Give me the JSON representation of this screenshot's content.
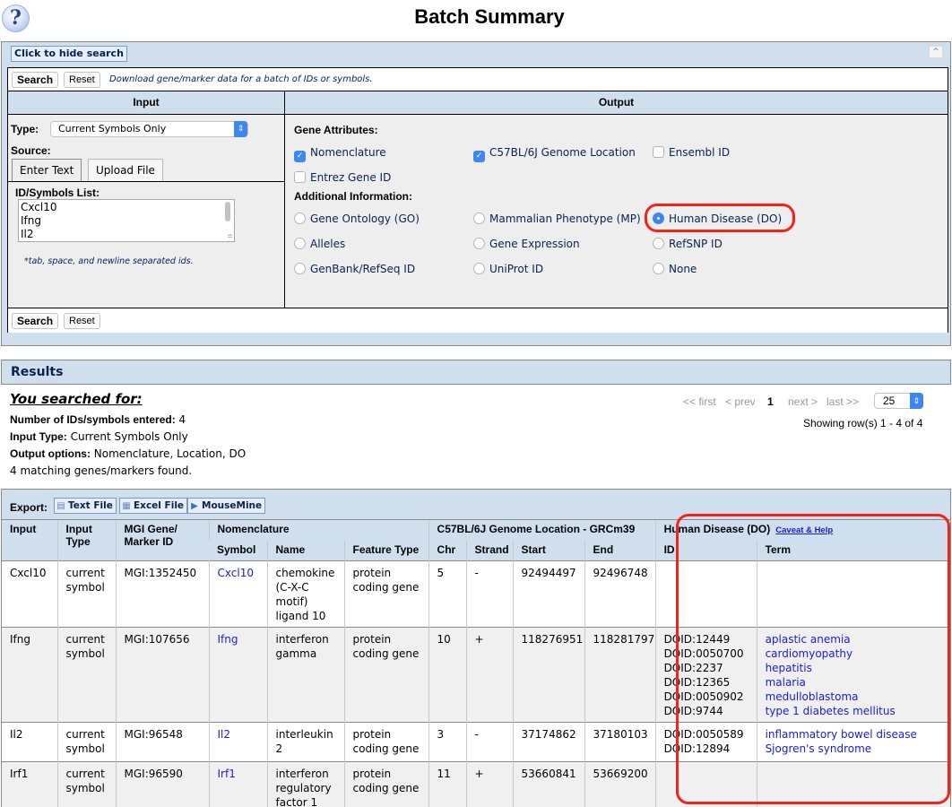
{
  "header": {
    "title": "Batch Summary",
    "help_icon_glyph": "?"
  },
  "query_form": {
    "hide_search_label": "Click to hide search",
    "collapse_icon_glyph": "^",
    "search_label": "Search",
    "reset_label": "Reset",
    "description": "Download gene/marker data for a batch of IDs or symbols.",
    "input": {
      "heading": "Input",
      "type_label": "Type:",
      "type_value": "Current Symbols Only",
      "source_label": "Source:",
      "tabs": [
        {
          "label": "Enter Text",
          "active": true
        },
        {
          "label": "Upload File",
          "active": false
        }
      ],
      "list_label": "ID/Symbols List:",
      "list_lines": [
        "Cxcl10",
        "Ifng",
        "Il2"
      ],
      "hint": "*tab, space, and newline separated ids."
    },
    "output": {
      "heading": "Output",
      "gene_attributes_label": "Gene Attributes:",
      "gene_attributes": [
        {
          "label": "Nomenclature",
          "checked": true
        },
        {
          "label": "C57BL/6J Genome Location",
          "checked": true
        },
        {
          "label": "Ensembl ID",
          "checked": false
        },
        {
          "label": "Entrez Gene ID",
          "checked": false
        }
      ],
      "additional_label": "Additional Information:",
      "additional": [
        {
          "label": "Gene Ontology (GO)",
          "selected": false
        },
        {
          "label": "Mammalian Phenotype (MP)",
          "selected": false
        },
        {
          "label": "Human Disease (DO)",
          "selected": true
        },
        {
          "label": "Alleles",
          "selected": false
        },
        {
          "label": "Gene Expression",
          "selected": false
        },
        {
          "label": "RefSNP ID",
          "selected": false
        },
        {
          "label": "GenBank/RefSeq ID",
          "selected": false
        },
        {
          "label": "UniProt ID",
          "selected": false
        },
        {
          "label": "None",
          "selected": false
        }
      ]
    }
  },
  "results": {
    "heading": "Results",
    "searched_for": "You searched for:",
    "summary": [
      {
        "label": "Number of IDs/symbols entered:",
        "value": " 4"
      },
      {
        "label": "Input Type:",
        "value": " Current Symbols Only"
      },
      {
        "label": "Output options:",
        "value": " Nomenclature, Location, DO"
      },
      {
        "label": "",
        "value": "4 matching genes/markers found."
      }
    ],
    "pager": {
      "first": "<< first",
      "prev": "< prev",
      "current": "1",
      "next": "next >",
      "last": "last >>",
      "page_size": "25",
      "showing": "Showing row(s) 1 - 4 of 4"
    },
    "export": {
      "label": "Export:",
      "buttons": [
        "Text File",
        "Excel File",
        "MouseMine"
      ]
    },
    "table": {
      "group_headers": {
        "nomenclature": "Nomenclature",
        "location": "C57BL/6J Genome Location - GRCm39",
        "disease": "Human Disease (DO)",
        "caveat": "Caveat & Help"
      },
      "columns": {
        "input": "Input",
        "input_type": "Input Type",
        "mgi_id": "MGI Gene/ Marker ID",
        "symbol": "Symbol",
        "name": "Name",
        "feature_type": "Feature Type",
        "chr": "Chr",
        "strand": "Strand",
        "start": "Start",
        "end": "End",
        "do_id": "ID",
        "do_term": "Term"
      },
      "rows": [
        {
          "input": "Cxcl10",
          "input_type": "current symbol",
          "mgi_id": "MGI:1352450",
          "symbol": "Cxcl10",
          "name": "chemokine (C-X-C motif) ligand 10",
          "feature_type": "protein coding gene",
          "chr": "5",
          "strand": "-",
          "start": "92494497",
          "end": "92496748",
          "do_ids": [],
          "do_terms": []
        },
        {
          "input": "Ifng",
          "input_type": "current symbol",
          "mgi_id": "MGI:107656",
          "symbol": "Ifng",
          "name": "interferon gamma",
          "feature_type": "protein coding gene",
          "chr": "10",
          "strand": "+",
          "start": "118276951",
          "end": "118281797",
          "do_ids": [
            "DOID:12449",
            "DOID:0050700",
            "DOID:2237",
            "DOID:12365",
            "DOID:0050902",
            "DOID:9744"
          ],
          "do_terms": [
            "aplastic anemia",
            "cardiomyopathy",
            "hepatitis",
            "malaria",
            "medulloblastoma",
            "type 1 diabetes mellitus"
          ]
        },
        {
          "input": "Il2",
          "input_type": "current symbol",
          "mgi_id": "MGI:96548",
          "symbol": "Il2",
          "name": "interleukin 2",
          "feature_type": "protein coding gene",
          "chr": "3",
          "strand": "-",
          "start": "37174862",
          "end": "37180103",
          "do_ids": [
            "DOID:0050589",
            "DOID:12894"
          ],
          "do_terms": [
            "inflammatory bowel disease",
            "Sjogren's syndrome"
          ]
        },
        {
          "input": "Irf1",
          "input_type": "current symbol",
          "mgi_id": "MGI:96590",
          "symbol": "Irf1",
          "name": "interferon regulatory factor 1",
          "feature_type": "protein coding gene",
          "chr": "11",
          "strand": "+",
          "start": "53660841",
          "end": "53669200",
          "do_ids": [],
          "do_terms": []
        }
      ]
    }
  },
  "annotations": {
    "highlight_color": "#f02418"
  }
}
